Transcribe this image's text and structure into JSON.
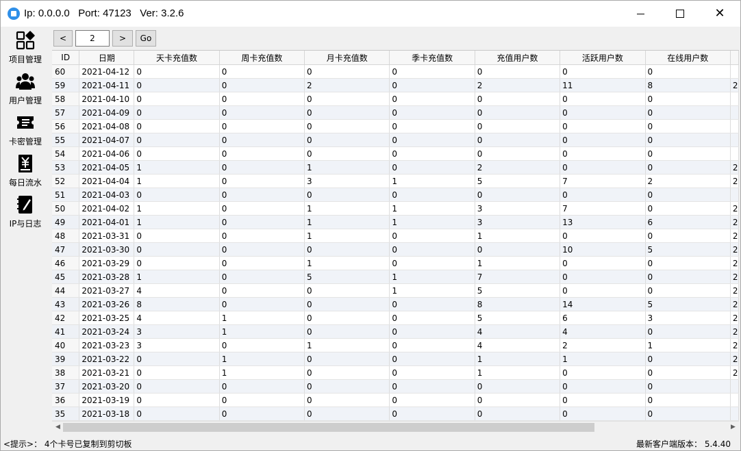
{
  "window": {
    "title": "Ip: 0.0.0.0   Port: 47123   Ver: 3.2.6"
  },
  "sidebar": {
    "items": [
      {
        "label": "项目管理",
        "icon": "grid-apps-icon"
      },
      {
        "label": "用户管理",
        "icon": "users-icon"
      },
      {
        "label": "卡密管理",
        "icon": "ticket-icon"
      },
      {
        "label": "每日流水",
        "icon": "yen-receipt-icon"
      },
      {
        "label": "IP与日志",
        "icon": "notebook-icon"
      }
    ]
  },
  "pager": {
    "prev_label": "<",
    "page": "2",
    "next_label": ">",
    "go_label": "Go"
  },
  "table": {
    "columns": [
      "ID",
      "日期",
      "天卡充值数",
      "周卡充值数",
      "月卡充值数",
      "季卡充值数",
      "充值用户数",
      "活跃用户数",
      "在线用户数"
    ],
    "rows": [
      [
        "60",
        "2021-04-12",
        "0",
        "0",
        "0",
        "0",
        "0",
        "0",
        "0",
        ""
      ],
      [
        "59",
        "2021-04-11",
        "0",
        "0",
        "2",
        "0",
        "2",
        "11",
        "8",
        "2"
      ],
      [
        "58",
        "2021-04-10",
        "0",
        "0",
        "0",
        "0",
        "0",
        "0",
        "0",
        ""
      ],
      [
        "57",
        "2021-04-09",
        "0",
        "0",
        "0",
        "0",
        "0",
        "0",
        "0",
        ""
      ],
      [
        "56",
        "2021-04-08",
        "0",
        "0",
        "0",
        "0",
        "0",
        "0",
        "0",
        ""
      ],
      [
        "55",
        "2021-04-07",
        "0",
        "0",
        "0",
        "0",
        "0",
        "0",
        "0",
        ""
      ],
      [
        "54",
        "2021-04-06",
        "0",
        "0",
        "0",
        "0",
        "0",
        "0",
        "0",
        ""
      ],
      [
        "53",
        "2021-04-05",
        "1",
        "0",
        "1",
        "0",
        "2",
        "0",
        "0",
        "2"
      ],
      [
        "52",
        "2021-04-04",
        "1",
        "0",
        "3",
        "1",
        "5",
        "7",
        "2",
        "2"
      ],
      [
        "51",
        "2021-04-03",
        "0",
        "0",
        "0",
        "0",
        "0",
        "0",
        "0",
        ""
      ],
      [
        "50",
        "2021-04-02",
        "1",
        "0",
        "1",
        "1",
        "3",
        "7",
        "0",
        "2"
      ],
      [
        "49",
        "2021-04-01",
        "1",
        "0",
        "1",
        "1",
        "3",
        "13",
        "6",
        "2"
      ],
      [
        "48",
        "2021-03-31",
        "0",
        "0",
        "1",
        "0",
        "1",
        "0",
        "0",
        "2"
      ],
      [
        "47",
        "2021-03-30",
        "0",
        "0",
        "0",
        "0",
        "0",
        "10",
        "5",
        "2"
      ],
      [
        "46",
        "2021-03-29",
        "0",
        "0",
        "1",
        "0",
        "1",
        "0",
        "0",
        "2"
      ],
      [
        "45",
        "2021-03-28",
        "1",
        "0",
        "5",
        "1",
        "7",
        "0",
        "0",
        "2"
      ],
      [
        "44",
        "2021-03-27",
        "4",
        "0",
        "0",
        "1",
        "5",
        "0",
        "0",
        "2"
      ],
      [
        "43",
        "2021-03-26",
        "8",
        "0",
        "0",
        "0",
        "8",
        "14",
        "5",
        "2"
      ],
      [
        "42",
        "2021-03-25",
        "4",
        "1",
        "0",
        "0",
        "5",
        "6",
        "3",
        "2"
      ],
      [
        "41",
        "2021-03-24",
        "3",
        "1",
        "0",
        "0",
        "4",
        "4",
        "0",
        "2"
      ],
      [
        "40",
        "2021-03-23",
        "3",
        "0",
        "1",
        "0",
        "4",
        "2",
        "1",
        "2"
      ],
      [
        "39",
        "2021-03-22",
        "0",
        "1",
        "0",
        "0",
        "1",
        "1",
        "0",
        "2"
      ],
      [
        "38",
        "2021-03-21",
        "0",
        "1",
        "0",
        "0",
        "1",
        "0",
        "0",
        "2"
      ],
      [
        "37",
        "2021-03-20",
        "0",
        "0",
        "0",
        "0",
        "0",
        "0",
        "0",
        ""
      ],
      [
        "36",
        "2021-03-19",
        "0",
        "0",
        "0",
        "0",
        "0",
        "0",
        "0",
        ""
      ],
      [
        "35",
        "2021-03-18",
        "0",
        "0",
        "0",
        "0",
        "0",
        "0",
        "0",
        ""
      ]
    ]
  },
  "status": {
    "hint": "<提示>：  4个卡号已复制到剪切板",
    "version": "最新客户端版本：  5.4.40"
  }
}
